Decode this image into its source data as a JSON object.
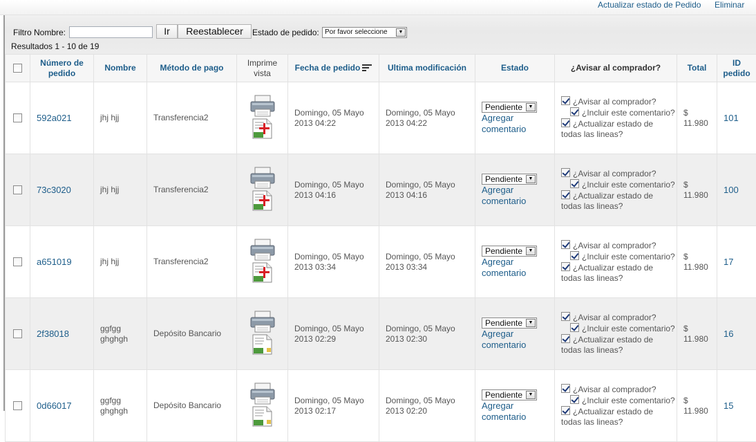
{
  "topbar": {
    "update_status": "Actualizar estado de Pedido",
    "delete": "Eliminar"
  },
  "filter": {
    "name_label": "Filtro Nombre:",
    "name_value": "",
    "go_label": "Ir",
    "reset_label": "Reestablecer",
    "status_label": "Estado de pedido:",
    "status_selected": "Por favor seleccione",
    "results": "Resultados 1 - 10 de 19"
  },
  "columns": {
    "order_number": "Número de pedido",
    "name": "Nombre",
    "payment": "Método de pago",
    "print": "Imprime vista",
    "order_date": "Fecha de pedido",
    "last_modified": "Ultima modificación",
    "status": "Estado",
    "notify": "¿Avisar al comprador?",
    "total": "Total",
    "id": "ID pedido"
  },
  "orders": [
    {
      "order_number": "592a021",
      "name": "jhj hjj",
      "payment": "Transferencia2",
      "print_icon": "printer-pdf-icon",
      "date": "Domingo, 05 Mayo 2013 04:22",
      "modified": "Domingo, 05 Mayo 2013 04:22",
      "status": "Pendiente",
      "add_comment": "Agregar comentario",
      "notify": "¿Avisar al comprador?",
      "include": "¿Incluir este comentario?",
      "update_lines": "¿Actualizar estado de todas las lineas?",
      "total": "$ 11.980",
      "id": "101"
    },
    {
      "order_number": "73c3020",
      "name": "jhj hjj",
      "payment": "Transferencia2",
      "print_icon": "printer-pdf-icon",
      "date": "Domingo, 05 Mayo 2013 04:16",
      "modified": "Domingo, 05 Mayo 2013 04:16",
      "status": "Pendiente",
      "add_comment": "Agregar comentario",
      "notify": "¿Avisar al comprador?",
      "include": "¿Incluir este comentario?",
      "update_lines": "¿Actualizar estado de todas las lineas?",
      "total": "$ 11.980",
      "id": "100"
    },
    {
      "order_number": "a651019",
      "name": "jhj hjj",
      "payment": "Transferencia2",
      "print_icon": "printer-pdf-icon",
      "date": "Domingo, 05 Mayo 2013 03:34",
      "modified": "Domingo, 05 Mayo 2013 03:34",
      "status": "Pendiente",
      "add_comment": "Agregar comentario",
      "notify": "¿Avisar al comprador?",
      "include": "¿Incluir este comentario?",
      "update_lines": "¿Actualizar estado de todas las lineas?",
      "total": "$ 11.980",
      "id": "17"
    },
    {
      "order_number": "2f38018",
      "name": "ggfgg ghghgh",
      "payment": "Depósito Bancario",
      "print_icon": "printer-invoice-icon",
      "date": "Domingo, 05 Mayo 2013 02:29",
      "modified": "Domingo, 05 Mayo 2013 02:30",
      "status": "Pendiente",
      "add_comment": "Agregar comentario",
      "notify": "¿Avisar al comprador?",
      "include": "¿Incluir este comentario?",
      "update_lines": "¿Actualizar estado de todas las lineas?",
      "total": "$ 11.980",
      "id": "16"
    },
    {
      "order_number": "0d66017",
      "name": "ggfgg ghghgh",
      "payment": "Depósito Bancario",
      "print_icon": "printer-invoice-icon",
      "date": "Domingo, 05 Mayo 2013 02:17",
      "modified": "Domingo, 05 Mayo 2013 02:20",
      "status": "Pendiente",
      "add_comment": "Agregar comentario",
      "notify": "¿Avisar al comprador?",
      "include": "¿Incluir este comentario?",
      "update_lines": "¿Actualizar estado de todas las lineas?",
      "total": "$ 11.980",
      "id": "15"
    }
  ]
}
